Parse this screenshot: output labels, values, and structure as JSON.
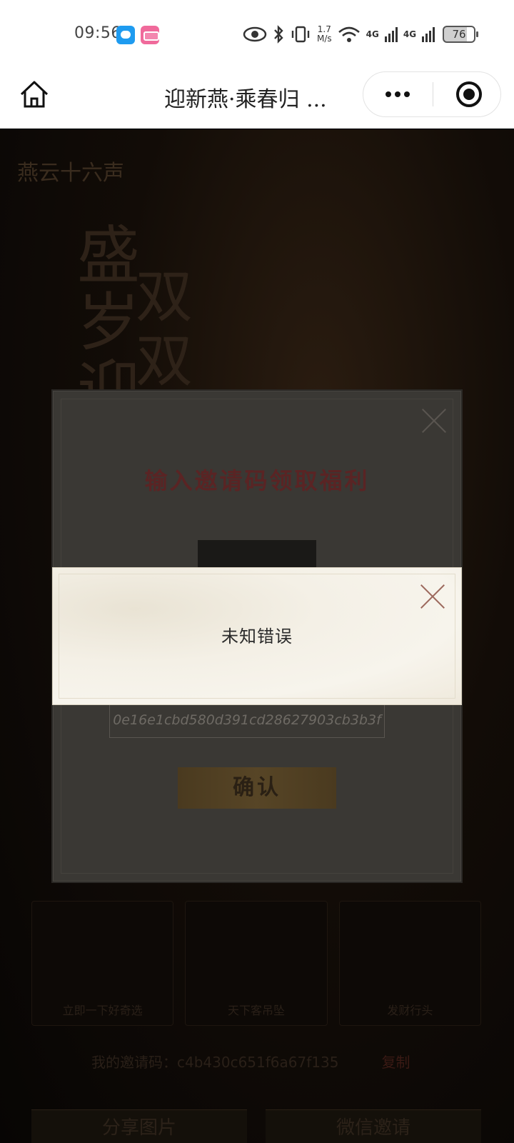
{
  "status_bar": {
    "time": "09:56",
    "net_speed_value": "1.7",
    "net_speed_unit": "M/s",
    "network_1": "4G",
    "network_2": "4G",
    "battery": "76"
  },
  "navbar": {
    "title": "迎新燕·乘春归 ..."
  },
  "background": {
    "brand": "燕云十六声",
    "title_left": "盛岁迎",
    "title_right": "双双",
    "invite_code_text": "我的邀请码：c4b430c651f6a67f135",
    "copy_label": "复制",
    "share_image_label": "分享图片",
    "wechat_invite_label": "微信邀请",
    "cards": [
      "立即一下好奇选",
      "天下客吊坠",
      "发财行头"
    ]
  },
  "invite_dialog": {
    "title": "输入邀请码领取福利",
    "code_value": "0e16e1cbd580d391cd28627903cb3b3f",
    "confirm_label": "确认"
  },
  "error_dialog": {
    "message": "未知错误"
  }
}
